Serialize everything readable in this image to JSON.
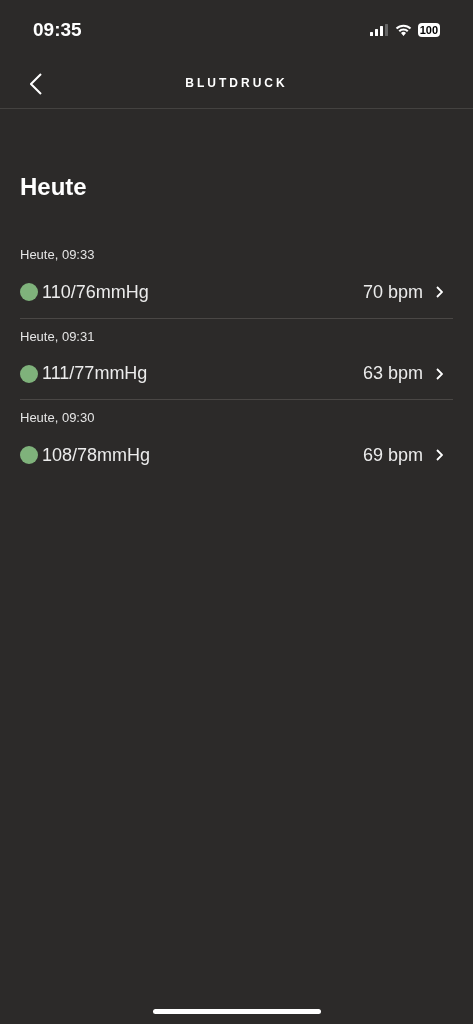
{
  "status_bar": {
    "time": "09:35",
    "battery": "100"
  },
  "nav": {
    "title": "BLUTDRUCK"
  },
  "section": {
    "title": "Heute"
  },
  "readings": [
    {
      "timestamp": "Heute, 09:33",
      "pressure": "110/76mmHg",
      "pulse": "70 bpm",
      "color": "#7fb27b"
    },
    {
      "timestamp": "Heute, 09:31",
      "pressure": "111/77mmHg",
      "pulse": "63 bpm",
      "color": "#7fb27b"
    },
    {
      "timestamp": "Heute, 09:30",
      "pressure": "108/78mmHg",
      "pulse": "69 bpm",
      "color": "#7fb27b"
    }
  ]
}
